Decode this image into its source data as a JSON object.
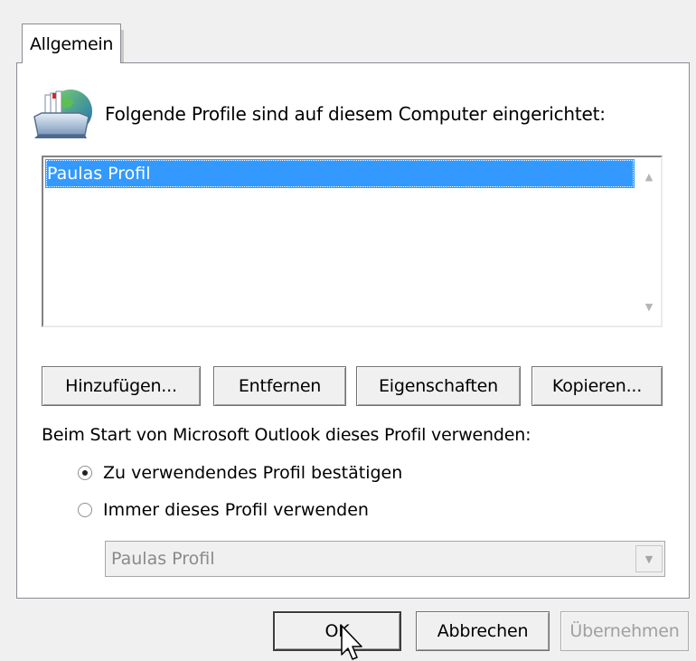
{
  "tabs": [
    {
      "label": "Allgemein",
      "selected": true
    }
  ],
  "header": {
    "text": "Folgende Profile sind auf diesem Computer eingerichtet:",
    "icon": "profiles-icon"
  },
  "profiles": {
    "items": [
      "Paulas Profil"
    ],
    "selected_index": 0
  },
  "profile_buttons": {
    "add": "Hinzufügen...",
    "remove": "Entfernen",
    "properties": "Eigenschaften",
    "copy": "Kopieren..."
  },
  "startup": {
    "label": "Beim Start von Microsoft Outlook dieses Profil verwenden:",
    "options": [
      {
        "label": "Zu verwendendes Profil bestätigen",
        "checked": true
      },
      {
        "label": "Immer dieses Profil verwenden",
        "checked": false
      }
    ],
    "profile_select": {
      "value": "Paulas Profil",
      "disabled": true
    }
  },
  "dialog_buttons": {
    "ok": "OK",
    "cancel": "Abbrechen",
    "apply": "Übernehmen"
  },
  "colors": {
    "selection": "#3399ff",
    "panel": "#ffffff",
    "background": "#f0f0f0"
  }
}
